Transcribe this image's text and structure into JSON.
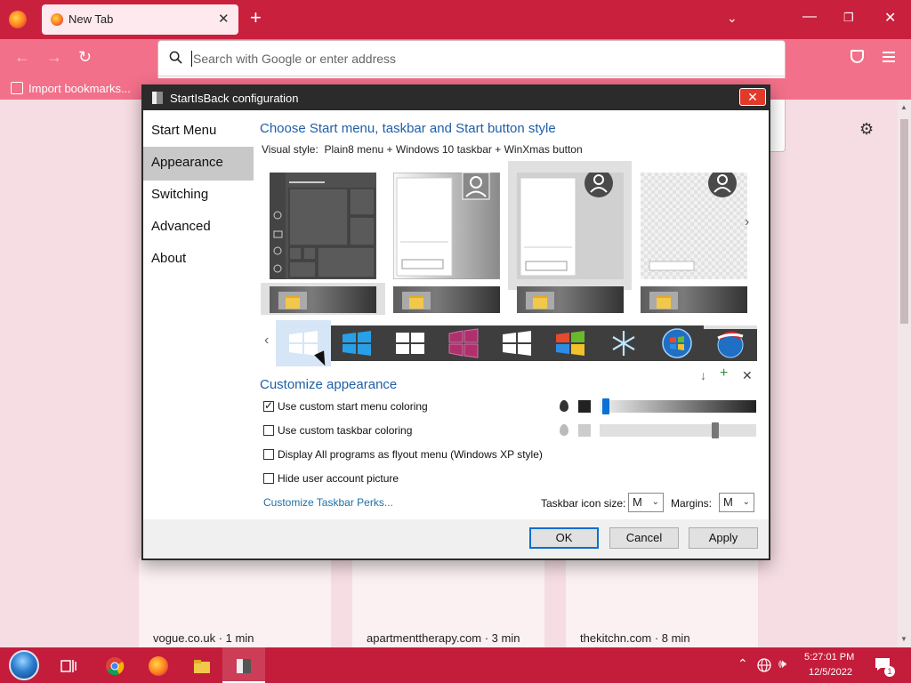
{
  "browser": {
    "tab_title": "New Tab",
    "url_placeholder": "Search with Google or enter address",
    "bookmark_label": "Import bookmarks...",
    "tiles": [
      {
        "label": "vogue.co.uk · 1 min"
      },
      {
        "label": "apartmenttherapy.com · 3 min"
      },
      {
        "label": "thekitchn.com · 8 min"
      }
    ]
  },
  "dialog": {
    "title": "StartIsBack configuration",
    "close_glyph": "✕",
    "nav": [
      "Start Menu",
      "Appearance",
      "Switching",
      "Advanced",
      "About"
    ],
    "active_nav": "Appearance",
    "style_title": "Choose Start menu, taskbar and Start button style",
    "visual_style_label": "Visual style:",
    "visual_style_value": "Plain8 menu + Windows 10 taskbar + WinXmas button",
    "customize_title": "Customize appearance",
    "options": [
      {
        "label": "Use custom start menu coloring",
        "checked": true
      },
      {
        "label": "Use custom taskbar coloring",
        "checked": false
      },
      {
        "label": "Display All programs as flyout menu (Windows XP style)",
        "checked": false
      },
      {
        "label": "Hide user account picture",
        "checked": false
      }
    ],
    "perks_link": "Customize Taskbar Perks...",
    "start_menu_color_level": 0.02,
    "taskbar_color_level": 0.75,
    "icon_size_label": "Taskbar icon size:",
    "icon_size_value": "M",
    "margins_label": "Margins:",
    "margins_value": "M",
    "buttons": {
      "ok": "OK",
      "cancel": "Cancel",
      "apply": "Apply"
    },
    "colors": {
      "accent": "#1f5fa8",
      "slider_thumb": "#0a6fd6",
      "close_red": "#e23a2a"
    }
  },
  "taskbar": {
    "time": "5:27:01 PM",
    "date": "12/5/2022",
    "notification_count": "1"
  }
}
